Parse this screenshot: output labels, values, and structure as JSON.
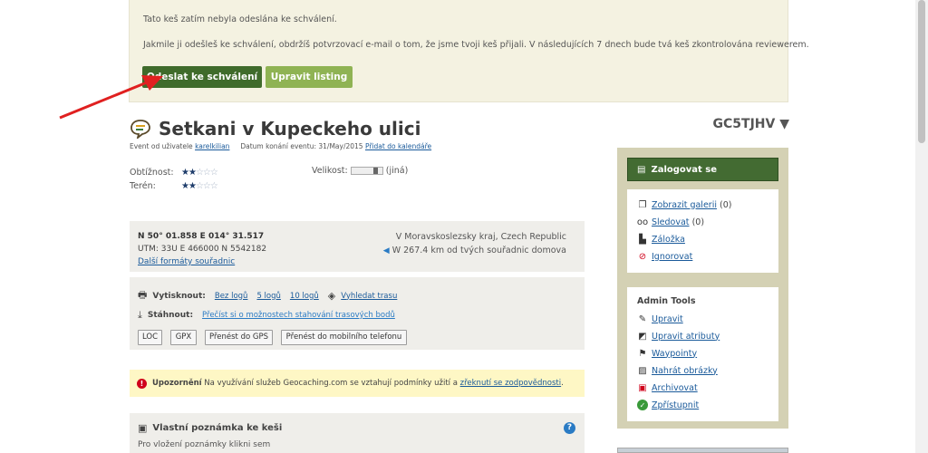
{
  "notice": {
    "line1": "Tato keš zatím nebyla odeslána ke schválení.",
    "line2": "Jakmile ji odešleš ke schválení, obdržíš potvrzovací e-mail o tom, že jsme tvoji keš přijali. V následujících 7 dnech bude tvá keš zkontrolována reviewerem.",
    "submit_label": "Odeslat ke schválení",
    "edit_label": "Upravit listing"
  },
  "cache": {
    "title": "Setkani v Kupeckeho ulici",
    "code": "GC5TJHV",
    "byline_prefix": "Event od uživatele",
    "owner": "karelkilian",
    "event_date_label": "Datum konání eventu:",
    "event_date": "31/May/2015",
    "calendar_link": "Přidat do kalendáře"
  },
  "attributes": {
    "difficulty_label": "Obtížnost:",
    "terrain_label": "Terén:",
    "difficulty_stars": "2 of 5 stars",
    "terrain_stars": "2 of 5 stars",
    "size_label": "Velikost:",
    "size_value": "(jiná)"
  },
  "coords": {
    "primary": "N 50° 01.858 E 014° 31.517",
    "utm": "UTM: 33U E 466000 N 5542182",
    "more_formats": "Další formáty souřadnic",
    "region": "V Moravskoslezsky kraj, Czech Republic",
    "distance": "W 267.4 km od tvých souřadnic domova"
  },
  "tools": {
    "print_label": "Vytisknout:",
    "print_options": [
      "Bez logů",
      "5 logů",
      "10 logů"
    ],
    "route_link": "Vyhledat trasu",
    "download_label": "Stáhnout:",
    "download_info": "Přečíst si o možnostech stahování trasových bodů",
    "buttons": [
      "LOC",
      "GPX",
      "Přenést do GPS",
      "Přenést do mobilního telefonu"
    ]
  },
  "warning": {
    "bold": "Upozornění",
    "text": "Na využívání služeb Geocaching.com se vztahují podmínky užití a",
    "link": "zřeknutí se zodpovědnosti",
    "end": "."
  },
  "personal_note": {
    "title": "Vlastní poznámka ke keši",
    "hint": "Pro vložení poznámky klikni sem"
  },
  "sidebar": {
    "login_label": "Zalogovat se",
    "links": [
      {
        "label": "Zobrazit galerii",
        "count": "(0)",
        "icon": "gallery-icon"
      },
      {
        "label": "Sledovat",
        "count": "(0)",
        "icon": "watch-glasses-icon"
      },
      {
        "label": "Záložka",
        "count": "",
        "icon": "bookmark-icon"
      },
      {
        "label": "Ignorovat",
        "count": "",
        "icon": "ignore-icon"
      }
    ],
    "admin_title": "Admin Tools",
    "admin_links": [
      {
        "label": "Upravit",
        "icon": "pencil-icon"
      },
      {
        "label": "Upravit atributy",
        "icon": "edit-attributes-icon"
      },
      {
        "label": "Waypointy",
        "icon": "flag-icon"
      },
      {
        "label": "Nahrát obrázky",
        "icon": "image-upload-icon"
      },
      {
        "label": "Archivovat",
        "icon": "archive-icon"
      },
      {
        "label": "Zpřístupnit",
        "icon": "enable-check-icon"
      }
    ]
  },
  "colors": {
    "submit_button": "#3f6b2b",
    "edit_button": "#8fb353",
    "sidebar_bg": "#d4d1b4",
    "warning_bg": "#fef7c5",
    "arrow": "#e02020"
  }
}
